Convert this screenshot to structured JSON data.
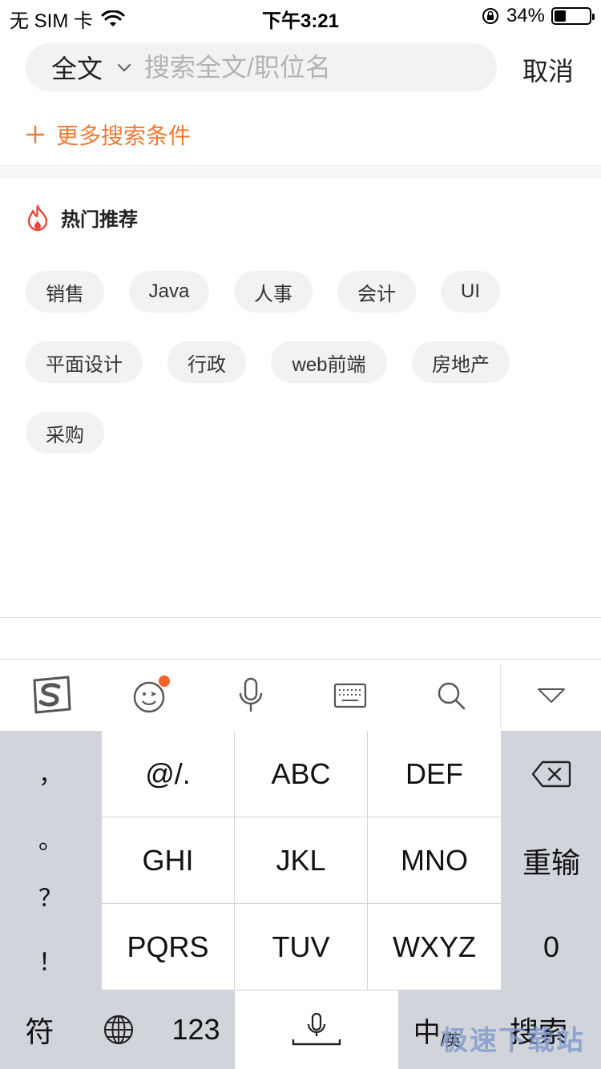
{
  "status_bar": {
    "carrier": "无 SIM 卡",
    "time": "下午3:21",
    "battery": "34%",
    "battery_level": 0.34
  },
  "search": {
    "scope": "全文",
    "placeholder": "搜索全文/职位名",
    "cancel_label": "取消"
  },
  "more_conditions_label": "更多搜索条件",
  "hot": {
    "title": "热门推荐",
    "tags": [
      "销售",
      "Java",
      "人事",
      "会计",
      "UI",
      "平面设计",
      "行政",
      "web前端",
      "房地产",
      "采购"
    ]
  },
  "ime_toolbar": {
    "icons": [
      "sogou-logo-icon",
      "emoji-icon",
      "microphone-icon",
      "keyboard-icon",
      "search-icon",
      "collapse-icon"
    ],
    "notification_color": "#f5632a"
  },
  "keyboard": {
    "punctuation": [
      "，",
      "。",
      "？",
      "！"
    ],
    "keys": [
      "@/.",
      "ABC",
      "DEF",
      "GHI",
      "JKL",
      "MNO",
      "PQRS",
      "TUV",
      "WXYZ"
    ],
    "delete_icon": "backspace-icon",
    "reset_label": "重输",
    "zero_label": "0",
    "symbol_label": "符",
    "globe_icon": "globe-icon",
    "num_label": "123",
    "space_icon": "mic-space-icon",
    "lang_main": "中",
    "lang_sub": "/英",
    "search_label": "搜索"
  },
  "watermark": "极速下载站",
  "colors": {
    "accent": "#f07a32",
    "flame": "#e8453c",
    "tag_bg": "#f2f2f2",
    "keyboard_bg": "#d1d4db"
  }
}
